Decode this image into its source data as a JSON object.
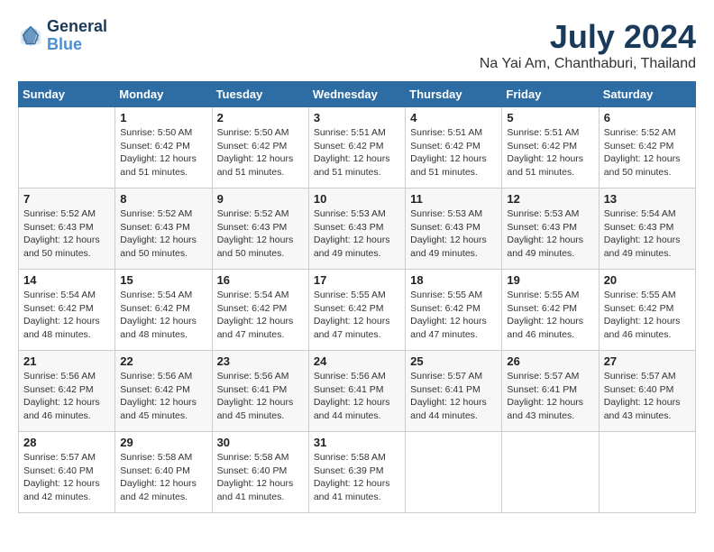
{
  "header": {
    "logo_line1": "General",
    "logo_line2": "Blue",
    "month": "July 2024",
    "location": "Na Yai Am, Chanthaburi, Thailand"
  },
  "weekdays": [
    "Sunday",
    "Monday",
    "Tuesday",
    "Wednesday",
    "Thursday",
    "Friday",
    "Saturday"
  ],
  "weeks": [
    [
      {
        "day": "",
        "sunrise": "",
        "sunset": "",
        "daylight": ""
      },
      {
        "day": "1",
        "sunrise": "Sunrise: 5:50 AM",
        "sunset": "Sunset: 6:42 PM",
        "daylight": "Daylight: 12 hours and 51 minutes."
      },
      {
        "day": "2",
        "sunrise": "Sunrise: 5:50 AM",
        "sunset": "Sunset: 6:42 PM",
        "daylight": "Daylight: 12 hours and 51 minutes."
      },
      {
        "day": "3",
        "sunrise": "Sunrise: 5:51 AM",
        "sunset": "Sunset: 6:42 PM",
        "daylight": "Daylight: 12 hours and 51 minutes."
      },
      {
        "day": "4",
        "sunrise": "Sunrise: 5:51 AM",
        "sunset": "Sunset: 6:42 PM",
        "daylight": "Daylight: 12 hours and 51 minutes."
      },
      {
        "day": "5",
        "sunrise": "Sunrise: 5:51 AM",
        "sunset": "Sunset: 6:42 PM",
        "daylight": "Daylight: 12 hours and 51 minutes."
      },
      {
        "day": "6",
        "sunrise": "Sunrise: 5:52 AM",
        "sunset": "Sunset: 6:42 PM",
        "daylight": "Daylight: 12 hours and 50 minutes."
      }
    ],
    [
      {
        "day": "7",
        "sunrise": "Sunrise: 5:52 AM",
        "sunset": "Sunset: 6:43 PM",
        "daylight": "Daylight: 12 hours and 50 minutes."
      },
      {
        "day": "8",
        "sunrise": "Sunrise: 5:52 AM",
        "sunset": "Sunset: 6:43 PM",
        "daylight": "Daylight: 12 hours and 50 minutes."
      },
      {
        "day": "9",
        "sunrise": "Sunrise: 5:52 AM",
        "sunset": "Sunset: 6:43 PM",
        "daylight": "Daylight: 12 hours and 50 minutes."
      },
      {
        "day": "10",
        "sunrise": "Sunrise: 5:53 AM",
        "sunset": "Sunset: 6:43 PM",
        "daylight": "Daylight: 12 hours and 49 minutes."
      },
      {
        "day": "11",
        "sunrise": "Sunrise: 5:53 AM",
        "sunset": "Sunset: 6:43 PM",
        "daylight": "Daylight: 12 hours and 49 minutes."
      },
      {
        "day": "12",
        "sunrise": "Sunrise: 5:53 AM",
        "sunset": "Sunset: 6:43 PM",
        "daylight": "Daylight: 12 hours and 49 minutes."
      },
      {
        "day": "13",
        "sunrise": "Sunrise: 5:54 AM",
        "sunset": "Sunset: 6:43 PM",
        "daylight": "Daylight: 12 hours and 49 minutes."
      }
    ],
    [
      {
        "day": "14",
        "sunrise": "Sunrise: 5:54 AM",
        "sunset": "Sunset: 6:42 PM",
        "daylight": "Daylight: 12 hours and 48 minutes."
      },
      {
        "day": "15",
        "sunrise": "Sunrise: 5:54 AM",
        "sunset": "Sunset: 6:42 PM",
        "daylight": "Daylight: 12 hours and 48 minutes."
      },
      {
        "day": "16",
        "sunrise": "Sunrise: 5:54 AM",
        "sunset": "Sunset: 6:42 PM",
        "daylight": "Daylight: 12 hours and 47 minutes."
      },
      {
        "day": "17",
        "sunrise": "Sunrise: 5:55 AM",
        "sunset": "Sunset: 6:42 PM",
        "daylight": "Daylight: 12 hours and 47 minutes."
      },
      {
        "day": "18",
        "sunrise": "Sunrise: 5:55 AM",
        "sunset": "Sunset: 6:42 PM",
        "daylight": "Daylight: 12 hours and 47 minutes."
      },
      {
        "day": "19",
        "sunrise": "Sunrise: 5:55 AM",
        "sunset": "Sunset: 6:42 PM",
        "daylight": "Daylight: 12 hours and 46 minutes."
      },
      {
        "day": "20",
        "sunrise": "Sunrise: 5:55 AM",
        "sunset": "Sunset: 6:42 PM",
        "daylight": "Daylight: 12 hours and 46 minutes."
      }
    ],
    [
      {
        "day": "21",
        "sunrise": "Sunrise: 5:56 AM",
        "sunset": "Sunset: 6:42 PM",
        "daylight": "Daylight: 12 hours and 46 minutes."
      },
      {
        "day": "22",
        "sunrise": "Sunrise: 5:56 AM",
        "sunset": "Sunset: 6:42 PM",
        "daylight": "Daylight: 12 hours and 45 minutes."
      },
      {
        "day": "23",
        "sunrise": "Sunrise: 5:56 AM",
        "sunset": "Sunset: 6:41 PM",
        "daylight": "Daylight: 12 hours and 45 minutes."
      },
      {
        "day": "24",
        "sunrise": "Sunrise: 5:56 AM",
        "sunset": "Sunset: 6:41 PM",
        "daylight": "Daylight: 12 hours and 44 minutes."
      },
      {
        "day": "25",
        "sunrise": "Sunrise: 5:57 AM",
        "sunset": "Sunset: 6:41 PM",
        "daylight": "Daylight: 12 hours and 44 minutes."
      },
      {
        "day": "26",
        "sunrise": "Sunrise: 5:57 AM",
        "sunset": "Sunset: 6:41 PM",
        "daylight": "Daylight: 12 hours and 43 minutes."
      },
      {
        "day": "27",
        "sunrise": "Sunrise: 5:57 AM",
        "sunset": "Sunset: 6:40 PM",
        "daylight": "Daylight: 12 hours and 43 minutes."
      }
    ],
    [
      {
        "day": "28",
        "sunrise": "Sunrise: 5:57 AM",
        "sunset": "Sunset: 6:40 PM",
        "daylight": "Daylight: 12 hours and 42 minutes."
      },
      {
        "day": "29",
        "sunrise": "Sunrise: 5:58 AM",
        "sunset": "Sunset: 6:40 PM",
        "daylight": "Daylight: 12 hours and 42 minutes."
      },
      {
        "day": "30",
        "sunrise": "Sunrise: 5:58 AM",
        "sunset": "Sunset: 6:40 PM",
        "daylight": "Daylight: 12 hours and 41 minutes."
      },
      {
        "day": "31",
        "sunrise": "Sunrise: 5:58 AM",
        "sunset": "Sunset: 6:39 PM",
        "daylight": "Daylight: 12 hours and 41 minutes."
      },
      {
        "day": "",
        "sunrise": "",
        "sunset": "",
        "daylight": ""
      },
      {
        "day": "",
        "sunrise": "",
        "sunset": "",
        "daylight": ""
      },
      {
        "day": "",
        "sunrise": "",
        "sunset": "",
        "daylight": ""
      }
    ]
  ]
}
